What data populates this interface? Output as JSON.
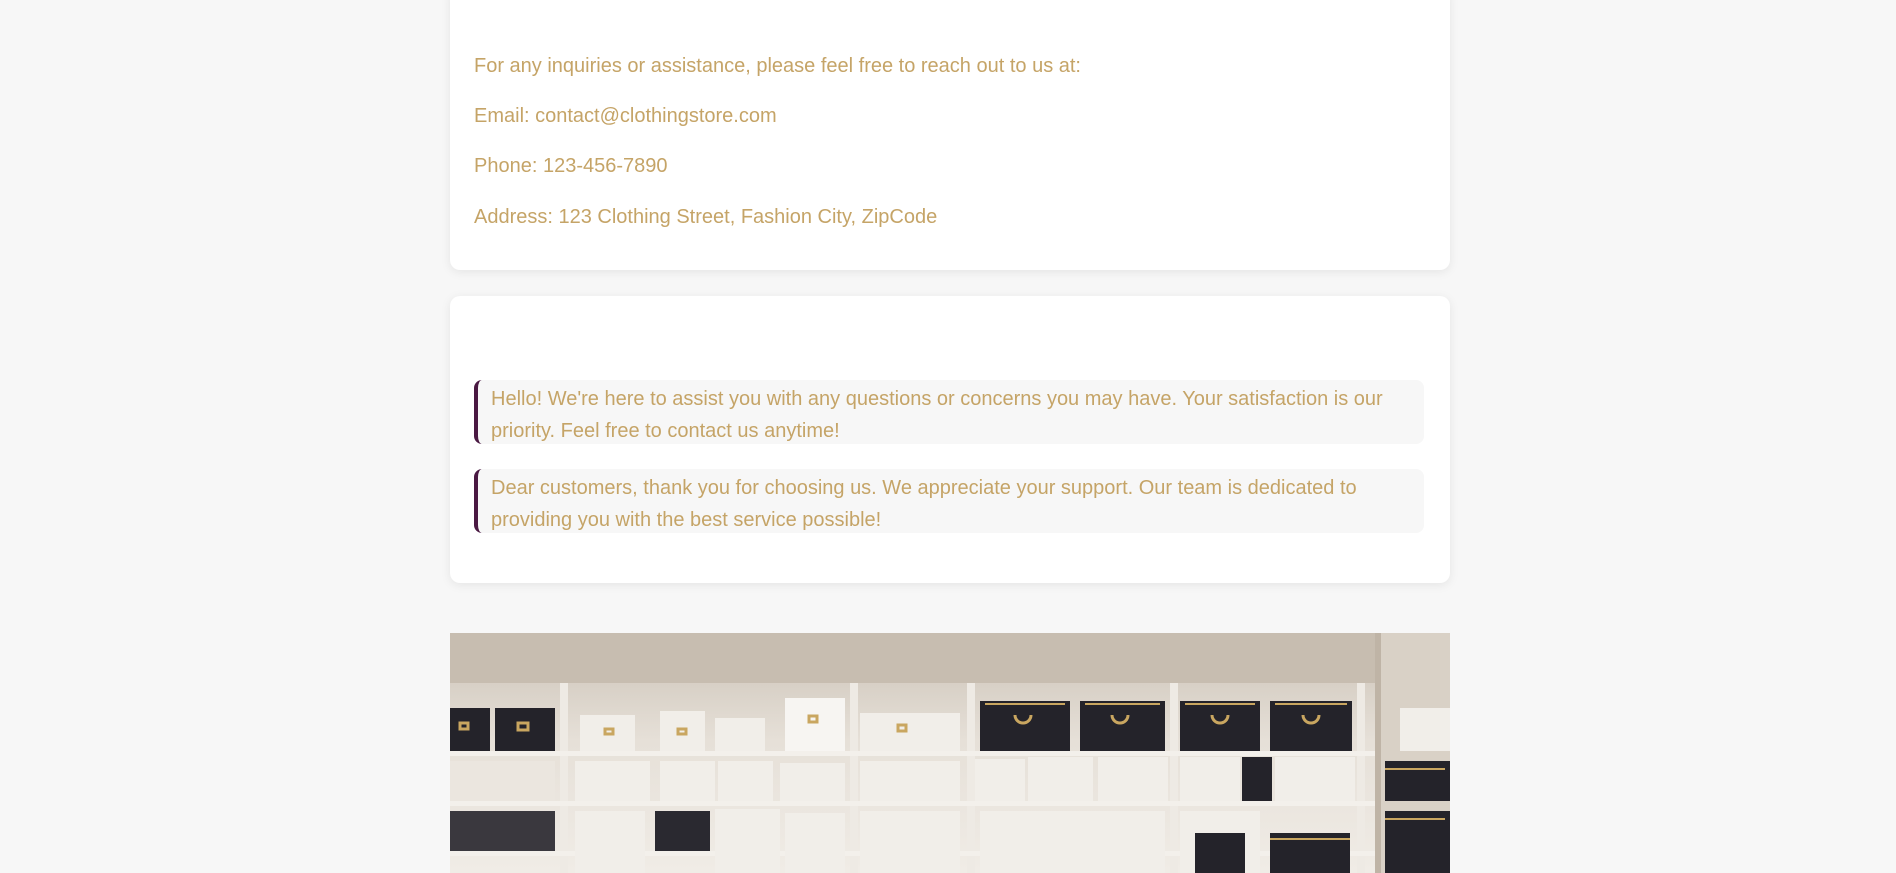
{
  "contact": {
    "intro": "For any inquiries or assistance, please feel free to reach out to us at:",
    "email": "Email: contact@clothingstore.com",
    "phone": "Phone: 123-456-7890",
    "address": "Address: 123 Clothing Street, Fashion City, ZipCode"
  },
  "messages": [
    "Hello! We're here to assist you with any questions or concerns you may have. Your satisfaction is our priority. Feel free to contact us anytime!",
    "Dear customers, thank you for choosing us. We appreciate your support. Our team is dedicated to providing you with the best service possible!"
  ],
  "colors": {
    "text_gold": "#c5a467",
    "accent_plum": "#4a1942",
    "page_bg": "#f7f7f7",
    "card_bg": "#ffffff"
  },
  "image": {
    "semantic": "clothing-store-shelving-photo"
  }
}
